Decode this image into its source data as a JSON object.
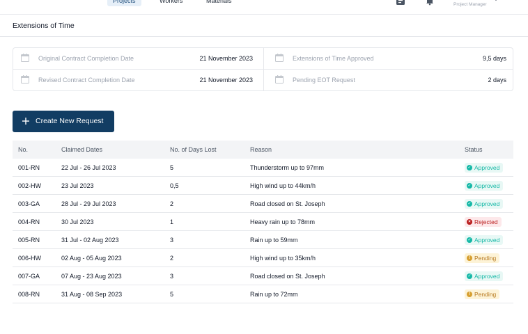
{
  "nav": {
    "tabs": [
      {
        "label": "Projects",
        "active": true
      },
      {
        "label": "Workers",
        "active": false
      },
      {
        "label": "Materials",
        "active": false
      }
    ],
    "role": "Project Manager",
    "icons": [
      "document-icon",
      "bell-icon",
      "chevron-down-icon"
    ]
  },
  "page": {
    "title": "Extensions of Time"
  },
  "summary": {
    "original_label": "Original Contract Completion Date",
    "original_value": "21 November 2023",
    "revised_label": "Revised Contract Completion Date",
    "revised_value": "21 November 2023",
    "approved_label": "Extensions of Time Approved",
    "approved_value": "9,5 days",
    "pending_label": "Pending EOT Request",
    "pending_value": "2 days"
  },
  "actions": {
    "create_label": "Create New Request"
  },
  "table": {
    "headers": {
      "no": "No.",
      "dates": "Claimed Dates",
      "days": "No. of Days Lost",
      "reason": "Reason",
      "status": "Status"
    },
    "rows": [
      {
        "no": "001-RN",
        "dates": "22 Jul - 26 Jul 2023",
        "days": "5",
        "reason": "Thunderstorm up to 97mm",
        "status": "Approved",
        "status_type": "approved"
      },
      {
        "no": "002-HW",
        "dates": "23 Jul 2023",
        "days": "0,5",
        "reason": "High wind up to 44km/h",
        "status": "Approved",
        "status_type": "approved"
      },
      {
        "no": "003-GA",
        "dates": "28 Jul - 29 Jul 2023",
        "days": "2",
        "reason": "Road closed on St. Joseph",
        "status": "Approved",
        "status_type": "approved"
      },
      {
        "no": "004-RN",
        "dates": "30 Jul 2023",
        "days": "1",
        "reason": "Heavy rain up to 78mm",
        "status": "Rejected",
        "status_type": "rejected"
      },
      {
        "no": "005-RN",
        "dates": "31 Jul - 02 Aug 2023",
        "days": "3",
        "reason": "Rain up to 59mm",
        "status": "Approved",
        "status_type": "approved"
      },
      {
        "no": "006-HW",
        "dates": "02 Aug - 05 Aug 2023",
        "days": "2",
        "reason": "High wind up to 35km/h",
        "status": "Pending",
        "status_type": "pending"
      },
      {
        "no": "007-GA",
        "dates": "07 Aug - 23 Aug 2023",
        "days": "3",
        "reason": "Road closed on St. Joseph",
        "status": "Approved",
        "status_type": "approved"
      },
      {
        "no": "008-RN",
        "dates": "31 Aug - 08 Sep 2023",
        "days": "5",
        "reason": "Rain up to 72mm",
        "status": "Pending",
        "status_type": "pending"
      }
    ]
  },
  "colors": {
    "primary": "#123d63",
    "approved": "#14b8a6",
    "rejected": "#b91c1c",
    "pending": "#d69e2e"
  }
}
